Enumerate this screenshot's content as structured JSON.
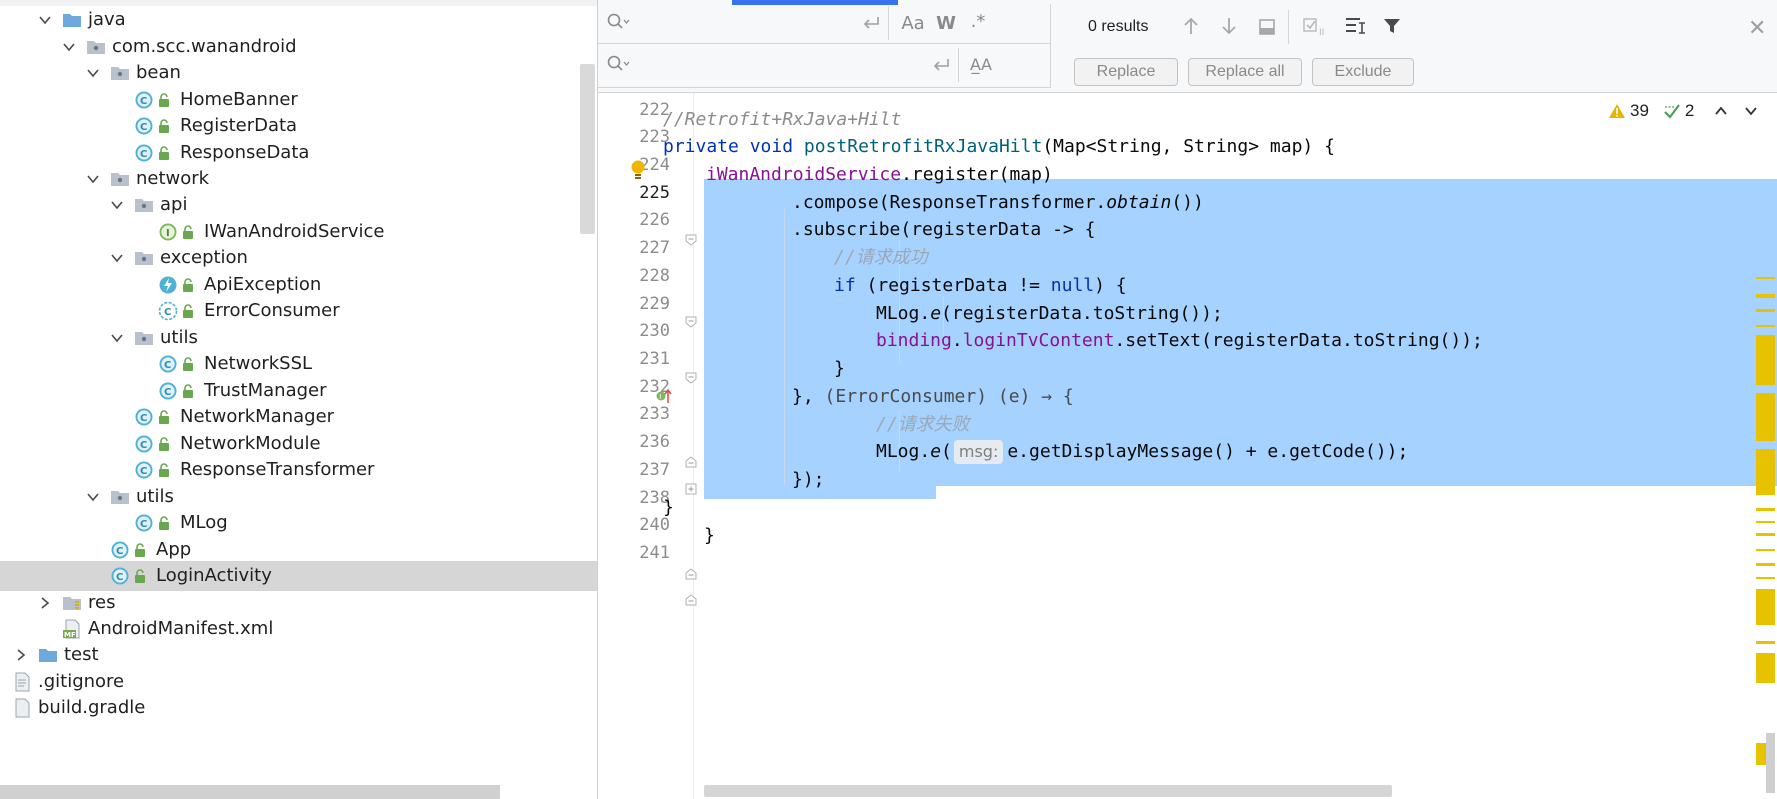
{
  "project_tree": {
    "items": [
      {
        "label": "java",
        "icon": "folder-icon"
      },
      {
        "label": "com.scc.wanandroid",
        "icon": "package-icon"
      },
      {
        "label": "bean",
        "icon": "package-icon"
      },
      {
        "label": "HomeBanner",
        "icon": "class-icon"
      },
      {
        "label": "RegisterData",
        "icon": "class-icon"
      },
      {
        "label": "ResponseData",
        "icon": "class-icon"
      },
      {
        "label": "network",
        "icon": "package-icon"
      },
      {
        "label": "api",
        "icon": "package-icon"
      },
      {
        "label": "IWanAndroidService",
        "icon": "interface-icon"
      },
      {
        "label": "exception",
        "icon": "package-icon"
      },
      {
        "label": "ApiException",
        "icon": "exception-class-icon"
      },
      {
        "label": "ErrorConsumer",
        "icon": "abstract-class-icon"
      },
      {
        "label": "utils",
        "icon": "package-icon"
      },
      {
        "label": "NetworkSSL",
        "icon": "class-icon"
      },
      {
        "label": "TrustManager",
        "icon": "class-icon"
      },
      {
        "label": "NetworkManager",
        "icon": "class-icon"
      },
      {
        "label": "NetworkModule",
        "icon": "class-icon"
      },
      {
        "label": "ResponseTransformer",
        "icon": "class-icon"
      },
      {
        "label": "utils",
        "icon": "package-icon"
      },
      {
        "label": "MLog",
        "icon": "class-icon"
      },
      {
        "label": "App",
        "icon": "class-icon"
      },
      {
        "label": "LoginActivity",
        "icon": "class-icon"
      },
      {
        "label": "res",
        "icon": "resources-folder-icon"
      },
      {
        "label": "AndroidManifest.xml",
        "icon": "manifest-file-icon"
      },
      {
        "label": "test",
        "icon": "folder-icon"
      },
      {
        "label": ".gitignore",
        "icon": "text-file-icon"
      },
      {
        "label": "build.gradle",
        "icon": "gradle-file-icon"
      }
    ],
    "selected": "LoginActivity"
  },
  "find_bar": {
    "results_text": "0 results",
    "case_toggle": "Aa",
    "word_toggle": "W",
    "regex_toggle": ".*",
    "preserve_case_toggle": "A̲A",
    "replace_label": "Replace",
    "replace_all_label": "Replace all",
    "exclude_label": "Exclude"
  },
  "inspections": {
    "warnings": "39",
    "weak_warnings": "2"
  },
  "editor": {
    "line_numbers": [
      "222",
      "223",
      "224",
      "225",
      "226",
      "227",
      "228",
      "229",
      "230",
      "231",
      "232",
      "233",
      "236",
      "237",
      "238",
      "240",
      "241"
    ],
    "current_line": "225",
    "code": {
      "l223": "//Retrofit+RxJava+Hilt",
      "l224_kw1": "private",
      "l224_kw2": "void",
      "l224_method": "postRetrofitRxJavaHilt",
      "l224_rest": "(Map<String, String> map) {",
      "l225_field": "iWanAndroidService",
      "l225_rest": ".register(map)",
      "l226_a": ".compose(ResponseTransformer.",
      "l226_it": "obtain",
      "l226_b": "())",
      "l227": ".subscribe(registerData -> {",
      "l228": "//请求成功",
      "l229_kw": "if",
      "l229_a": " (registerData != ",
      "l229_null": "null",
      "l229_b": ") {",
      "l230_a": "MLog.",
      "l230_it": "e",
      "l230_b": "(registerData.toString());",
      "l231_field1": "binding",
      "l231_dot": ".",
      "l231_field2": "loginTvContent",
      "l231_rest": ".setText(registerData.toString());",
      "l232": "}",
      "l233_a": "}, ",
      "l233_fold": "(ErrorConsumer) (e) → {",
      "l236": "//请求失败",
      "l237_a": "MLog.",
      "l237_it": "e",
      "l237_paren": "(",
      "l237_hint": "msg:",
      "l237_b": "e.getDisplayMessage() + e.getCode());",
      "l238": "});",
      "l240": "}",
      "l241": "}"
    }
  },
  "colors": {
    "selection": "#a6d2ff",
    "keyword": "#0033b3",
    "field": "#871094",
    "comment": "#8c8c8c",
    "warning_stripe": "#e6c200"
  }
}
